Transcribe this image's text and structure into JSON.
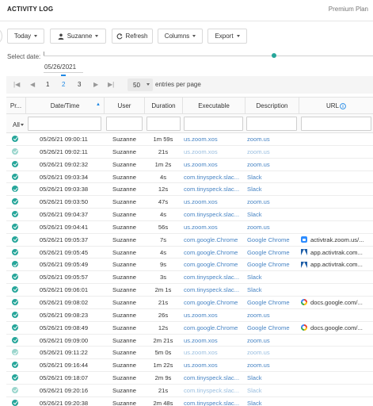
{
  "header": {
    "title": "ACTIVITY LOG",
    "plan": "Premium Plan"
  },
  "toolbar": {
    "today_label": "Today",
    "user_label": "Suzanne",
    "refresh_label": "Refresh",
    "columns_label": "Columns",
    "export_label": "Export"
  },
  "date_filter": {
    "label": "Select date:",
    "selected_date": "05/26/2021"
  },
  "pager": {
    "pages": [
      "1",
      "2",
      "3"
    ],
    "current_page": "2",
    "page_size": "50",
    "page_size_suffix": "entries per page"
  },
  "columns": {
    "status": "Pr...",
    "datetime": "Date/Time",
    "user": "User",
    "duration": "Duration",
    "executable": "Executable",
    "description": "Description",
    "url": "URL"
  },
  "filter": {
    "status_value": "All"
  },
  "colors": {
    "accent": "#1e88e5",
    "success": "#26a69a",
    "link": "#4a86c5"
  },
  "rows": [
    {
      "status": "check-icon",
      "datetime": "05/26/21 09:00:11",
      "user": "Suzanne",
      "duration": "1m 59s",
      "executable": "us.zoom.xos",
      "description": "zoom.us",
      "url": "",
      "url_icon": ""
    },
    {
      "status": "check-icon-light",
      "datetime": "05/26/21 09:02:11",
      "user": "Suzanne",
      "duration": "21s",
      "executable": "us.zoom.xos",
      "description": "zoom.us",
      "url": "",
      "url_icon": ""
    },
    {
      "status": "check-icon",
      "datetime": "05/26/21 09:02:32",
      "user": "Suzanne",
      "duration": "1m 2s",
      "executable": "us.zoom.xos",
      "description": "zoom.us",
      "url": "",
      "url_icon": ""
    },
    {
      "status": "check-icon",
      "datetime": "05/26/21 09:03:34",
      "user": "Suzanne",
      "duration": "4s",
      "executable": "com.tinyspeck.slac...",
      "description": "Slack",
      "url": "",
      "url_icon": ""
    },
    {
      "status": "check-icon",
      "datetime": "05/26/21 09:03:38",
      "user": "Suzanne",
      "duration": "12s",
      "executable": "com.tinyspeck.slac...",
      "description": "Slack",
      "url": "",
      "url_icon": ""
    },
    {
      "status": "check-icon",
      "datetime": "05/26/21 09:03:50",
      "user": "Suzanne",
      "duration": "47s",
      "executable": "us.zoom.xos",
      "description": "zoom.us",
      "url": "",
      "url_icon": ""
    },
    {
      "status": "check-icon",
      "datetime": "05/26/21 09:04:37",
      "user": "Suzanne",
      "duration": "4s",
      "executable": "com.tinyspeck.slac...",
      "description": "Slack",
      "url": "",
      "url_icon": ""
    },
    {
      "status": "check-icon",
      "datetime": "05/26/21 09:04:41",
      "user": "Suzanne",
      "duration": "56s",
      "executable": "us.zoom.xos",
      "description": "zoom.us",
      "url": "",
      "url_icon": ""
    },
    {
      "status": "check-icon",
      "datetime": "05/26/21 09:05:37",
      "user": "Suzanne",
      "duration": "7s",
      "executable": "com.google.Chrome",
      "description": "Google Chrome",
      "url": "activtrak.zoom.us/...",
      "url_icon": "zoom-icon"
    },
    {
      "status": "check-icon",
      "datetime": "05/26/21 09:05:45",
      "user": "Suzanne",
      "duration": "4s",
      "executable": "com.google.Chrome",
      "description": "Google Chrome",
      "url": "app.activtrak.com...",
      "url_icon": "activtrak-icon"
    },
    {
      "status": "check-icon",
      "datetime": "05/26/21 09:05:49",
      "user": "Suzanne",
      "duration": "9s",
      "executable": "com.google.Chrome",
      "description": "Google Chrome",
      "url": "app.activtrak.com...",
      "url_icon": "activtrak-icon"
    },
    {
      "status": "check-icon",
      "datetime": "05/26/21 09:05:57",
      "user": "Suzanne",
      "duration": "3s",
      "executable": "com.tinyspeck.slac...",
      "description": "Slack",
      "url": "",
      "url_icon": ""
    },
    {
      "status": "check-icon",
      "datetime": "05/26/21 09:06:01",
      "user": "Suzanne",
      "duration": "2m 1s",
      "executable": "com.tinyspeck.slac...",
      "description": "Slack",
      "url": "",
      "url_icon": ""
    },
    {
      "status": "check-icon",
      "datetime": "05/26/21 09:08:02",
      "user": "Suzanne",
      "duration": "21s",
      "executable": "com.google.Chrome",
      "description": "Google Chrome",
      "url": "docs.google.com/...",
      "url_icon": "google-icon"
    },
    {
      "status": "check-icon",
      "datetime": "05/26/21 09:08:23",
      "user": "Suzanne",
      "duration": "26s",
      "executable": "us.zoom.xos",
      "description": "zoom.us",
      "url": "",
      "url_icon": ""
    },
    {
      "status": "check-icon",
      "datetime": "05/26/21 09:08:49",
      "user": "Suzanne",
      "duration": "12s",
      "executable": "com.google.Chrome",
      "description": "Google Chrome",
      "url": "docs.google.com/...",
      "url_icon": "google-icon"
    },
    {
      "status": "check-icon",
      "datetime": "05/26/21 09:09:00",
      "user": "Suzanne",
      "duration": "2m 21s",
      "executable": "us.zoom.xos",
      "description": "zoom.us",
      "url": "",
      "url_icon": ""
    },
    {
      "status": "check-icon-light",
      "datetime": "05/26/21 09:11:22",
      "user": "Suzanne",
      "duration": "5m 0s",
      "executable": "us.zoom.xos",
      "description": "zoom.us",
      "url": "",
      "url_icon": ""
    },
    {
      "status": "check-icon",
      "datetime": "05/26/21 09:16:44",
      "user": "Suzanne",
      "duration": "1m 22s",
      "executable": "us.zoom.xos",
      "description": "zoom.us",
      "url": "",
      "url_icon": ""
    },
    {
      "status": "check-icon",
      "datetime": "05/26/21 09:18:07",
      "user": "Suzanne",
      "duration": "2m 9s",
      "executable": "com.tinyspeck.slac...",
      "description": "Slack",
      "url": "",
      "url_icon": ""
    },
    {
      "status": "check-icon-light",
      "datetime": "05/26/21 09:20:16",
      "user": "Suzanne",
      "duration": "21s",
      "executable": "com.tinyspeck.slac...",
      "description": "Slack",
      "url": "",
      "url_icon": ""
    },
    {
      "status": "check-icon",
      "datetime": "05/26/21 09:20:38",
      "user": "Suzanne",
      "duration": "2m 48s",
      "executable": "com.tinyspeck.slac...",
      "description": "Slack",
      "url": "",
      "url_icon": ""
    }
  ]
}
